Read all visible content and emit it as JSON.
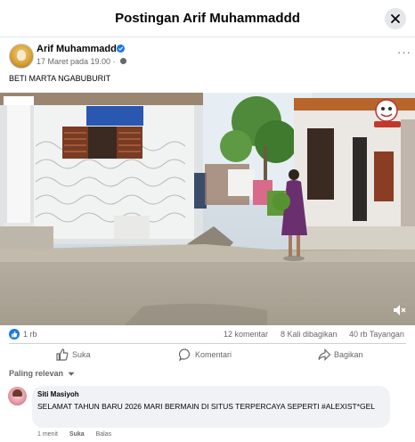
{
  "header": {
    "title": "Postingan Arif Muhammaddd"
  },
  "post": {
    "author": "Arif Muhammaddd",
    "time": "17 Maret pada 19.00 ·",
    "caption": "BETI MARTA NGABUBURIT",
    "more_label": "···"
  },
  "icons": {
    "close": "close-icon",
    "verified": "verified-badge-icon",
    "globe": "globe-icon",
    "like": "thumbs-up-icon",
    "comment": "comment-bubble-icon",
    "share": "share-arrow-icon",
    "mute": "speaker-muted-icon"
  },
  "stats": {
    "likes": "1 rb",
    "comments": "12 komentar",
    "shares": "8 Kali dibagikan",
    "views": "40 rb Tayangan"
  },
  "actions": {
    "like": "Suka",
    "comment": "Komentari",
    "share": "Bagikan"
  },
  "filter": {
    "label": "Paling relevan"
  },
  "comment": {
    "author": "Siti Masiyoh",
    "text": "SELAMAT TAHUN BARU 2026 MARI BERMAIN DI SITUS TERPERCAYA SEPERTI #ALEXIST*GEL",
    "time": "1 menit",
    "like": "Suka",
    "reply": "Balas"
  },
  "colors": {
    "accent": "#1877f2",
    "text": "#050505",
    "muted": "#65676b",
    "bubble": "#f0f2f5"
  }
}
